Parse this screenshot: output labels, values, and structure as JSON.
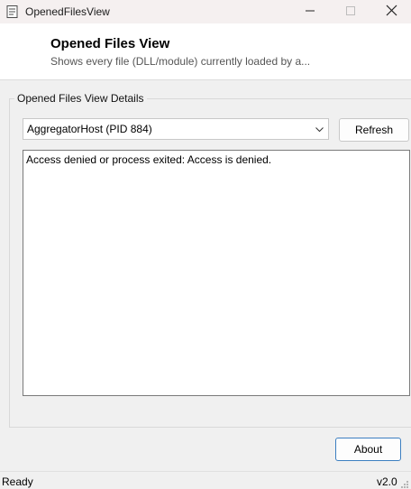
{
  "window": {
    "title": "OpenedFilesView",
    "icons": {
      "app": "document-icon",
      "minimize": "minimize-icon",
      "maximize": "maximize-icon",
      "close": "close-icon"
    }
  },
  "header": {
    "title": "Opened Files View",
    "subtitle": "Shows every file (DLL/module) currently loaded by a..."
  },
  "group": {
    "legend": "Opened Files View Details"
  },
  "process_select": {
    "selected": "AggregatorHost (PID 884)"
  },
  "buttons": {
    "refresh": "Refresh",
    "about": "About"
  },
  "output": {
    "text": "Access denied or process exited: Access is denied."
  },
  "status": {
    "left": "Ready",
    "right": "v2.0"
  },
  "colors": {
    "titlebar": "#f5f0f0",
    "header_bg": "#ffffff",
    "window_bg": "#f0f0f0",
    "accent_border": "#3c7fc1"
  }
}
